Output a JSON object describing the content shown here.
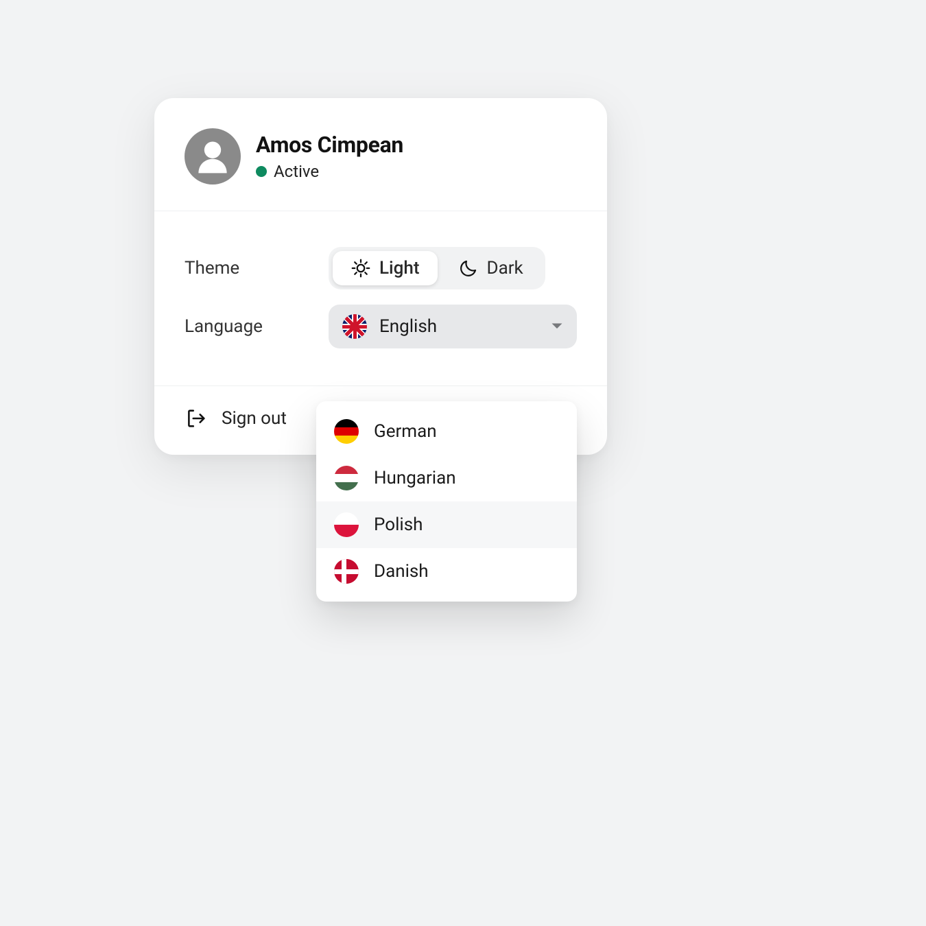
{
  "user": {
    "name": "Amos Cimpean",
    "status_label": "Active",
    "status_color": "#0e8a5f"
  },
  "theme": {
    "label": "Theme",
    "options": [
      {
        "label": "Light",
        "icon": "sun-icon",
        "active": true
      },
      {
        "label": "Dark",
        "icon": "moon-icon",
        "active": false
      }
    ]
  },
  "language": {
    "label": "Language",
    "selected": {
      "label": "English",
      "flag": "flag-uk"
    },
    "options": [
      {
        "label": "German",
        "flag": "flag-de",
        "hover": false
      },
      {
        "label": "Hungarian",
        "flag": "flag-hu",
        "hover": false
      },
      {
        "label": "Polish",
        "flag": "flag-pl",
        "hover": true
      },
      {
        "label": "Danish",
        "flag": "flag-dk",
        "hover": false
      }
    ]
  },
  "signout": {
    "label": "Sign out"
  }
}
